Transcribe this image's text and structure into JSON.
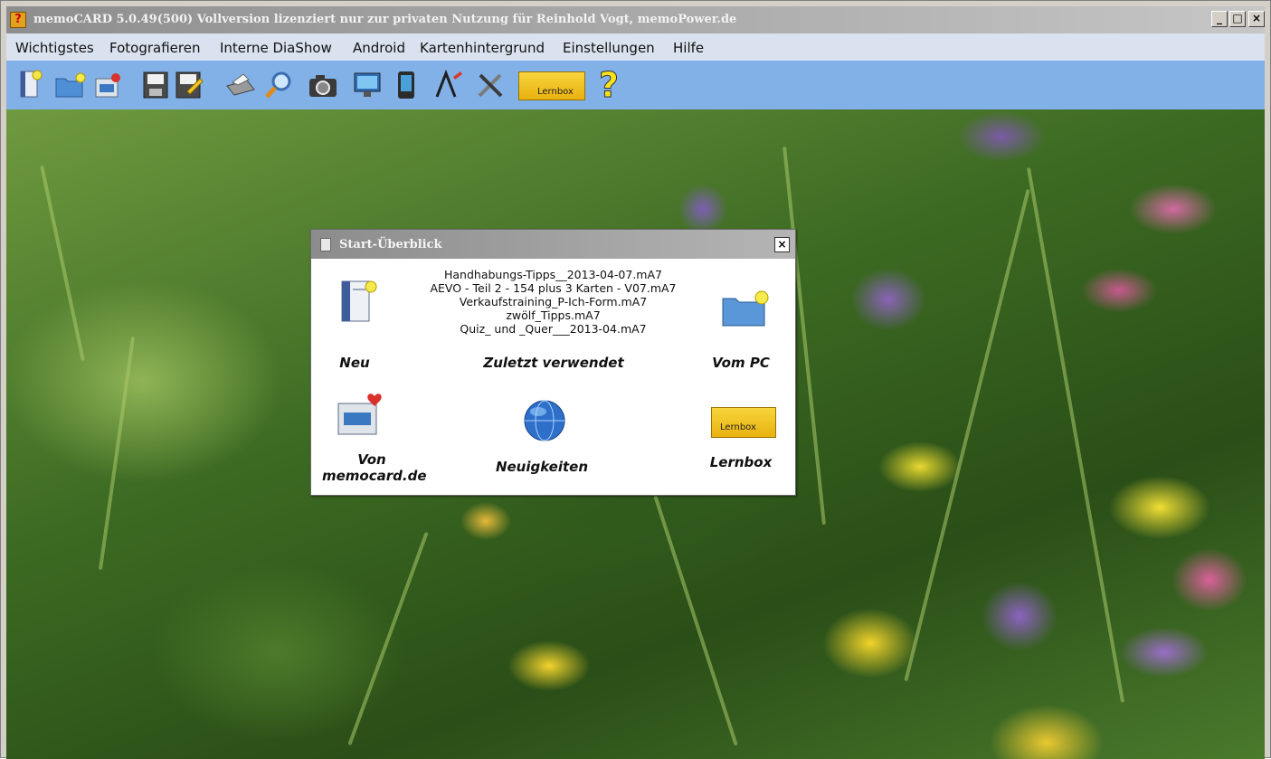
{
  "window": {
    "title": "memoCARD 5.0.49(500)  Vollversion lizenziert nur zur privaten Nutzung für Reinhold Vogt, memoPower.de",
    "app_icon": "question-mark-icon",
    "controls": {
      "minimize": "_",
      "maximize": "□",
      "close": "×"
    }
  },
  "menubar": {
    "items": [
      "Wichtigstes",
      "Fotografieren",
      "Interne DiaShow",
      "Android",
      "Kartenhintergrund",
      "Einstellungen",
      "Hilfe"
    ]
  },
  "toolbar": {
    "icons": [
      "new-card-icon",
      "open-folder-icon",
      "web-download-icon",
      "save-icon",
      "save-as-icon",
      "print-icon",
      "search-icon",
      "camera-icon",
      "slideshow-icon",
      "android-icon",
      "font-icon",
      "tools-icon",
      "lernbox-icon",
      "help-icon"
    ],
    "lernbox_label": "Lernbox",
    "help_glyph": "?"
  },
  "dialog": {
    "title": "Start-Überblick",
    "close": "×",
    "recent_files": [
      "Handhabungs-Tipps__2013-04-07.mA7",
      "AEVO - Teil 2 - 154 plus 3 Karten - V07.mA7",
      "Verkaufstraining_P-Ich-Form.mA7",
      "zwölf_Tipps.mA7",
      "Quiz_ und _Quer___2013-04.mA7"
    ],
    "actions": {
      "new": "Neu",
      "recent": "Zuletzt verwendet",
      "from_pc": "Vom PC",
      "from_web_line1": "Von",
      "from_web_line2": "memocard.de",
      "news": "Neuigkeiten",
      "lernbox": "Lernbox"
    },
    "lernbox_box_label": "Lernbox"
  }
}
